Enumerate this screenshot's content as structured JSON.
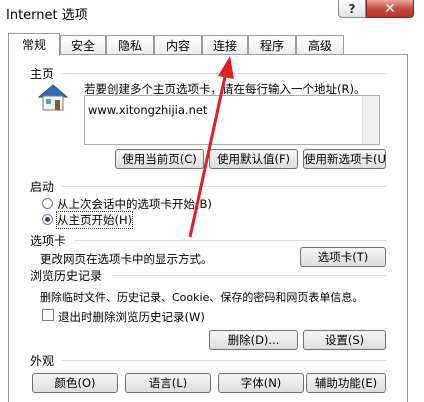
{
  "window": {
    "title": "Internet 选项",
    "help_label": "?",
    "close_label": "✕"
  },
  "tabs": [
    {
      "label": "常规"
    },
    {
      "label": "安全"
    },
    {
      "label": "隐私"
    },
    {
      "label": "内容"
    },
    {
      "label": "连接"
    },
    {
      "label": "程序"
    },
    {
      "label": "高级"
    }
  ],
  "home": {
    "heading": "主页",
    "instruction": "若要创建多个主页选项卡，请在每行输入一个地址(R)。",
    "url": "www.xitongzhijia.net",
    "btn_current": "使用当前页(C)",
    "btn_default": "使用默认值(F)",
    "btn_newtab": "使用新选项卡(U)"
  },
  "startup": {
    "heading": "启动",
    "opt_last": "从上次会话中的选项卡开始(B)",
    "opt_home": "从主页开始(H)"
  },
  "tabsec": {
    "heading": "选项卡",
    "desc": "更改网页在选项卡中的显示方式。",
    "btn": "选项卡(T)"
  },
  "history": {
    "heading": "浏览历史记录",
    "desc": "删除临时文件、历史记录、Cookie、保存的密码和网页表单信息。",
    "checkbox": "退出时删除浏览历史记录(W)",
    "btn_delete": "删除(D)...",
    "btn_settings": "设置(S)"
  },
  "appearance": {
    "heading": "外观",
    "btn_colors": "颜色(O)",
    "btn_languages": "语言(L)",
    "btn_fonts": "字体(N)",
    "btn_access": "辅助功能(E)"
  },
  "colors": {
    "arrow": "#e02020"
  }
}
